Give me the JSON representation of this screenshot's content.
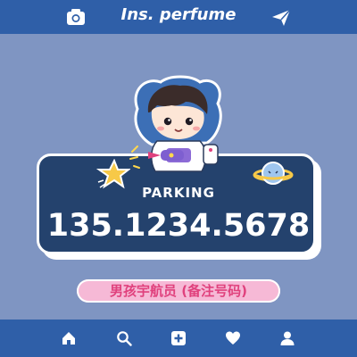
{
  "header": {
    "title": "Ins. perfume",
    "left_icon": "camera-icon",
    "right_icon": "send-icon"
  },
  "card": {
    "label": "PARKING",
    "phone": "135.1234.5678"
  },
  "tag": {
    "text": "男孩宇航员 (备注号码)"
  },
  "bottom_nav": {
    "items": [
      {
        "icon": "home-icon"
      },
      {
        "icon": "search-icon"
      },
      {
        "icon": "add-icon"
      },
      {
        "icon": "heart-icon"
      },
      {
        "icon": "profile-icon"
      }
    ]
  },
  "colors": {
    "background": "#7f95c2",
    "bar": "#2f5fa8",
    "card": "#24426d",
    "tag": "#f6b9d6",
    "tag_text": "#e0417d"
  }
}
